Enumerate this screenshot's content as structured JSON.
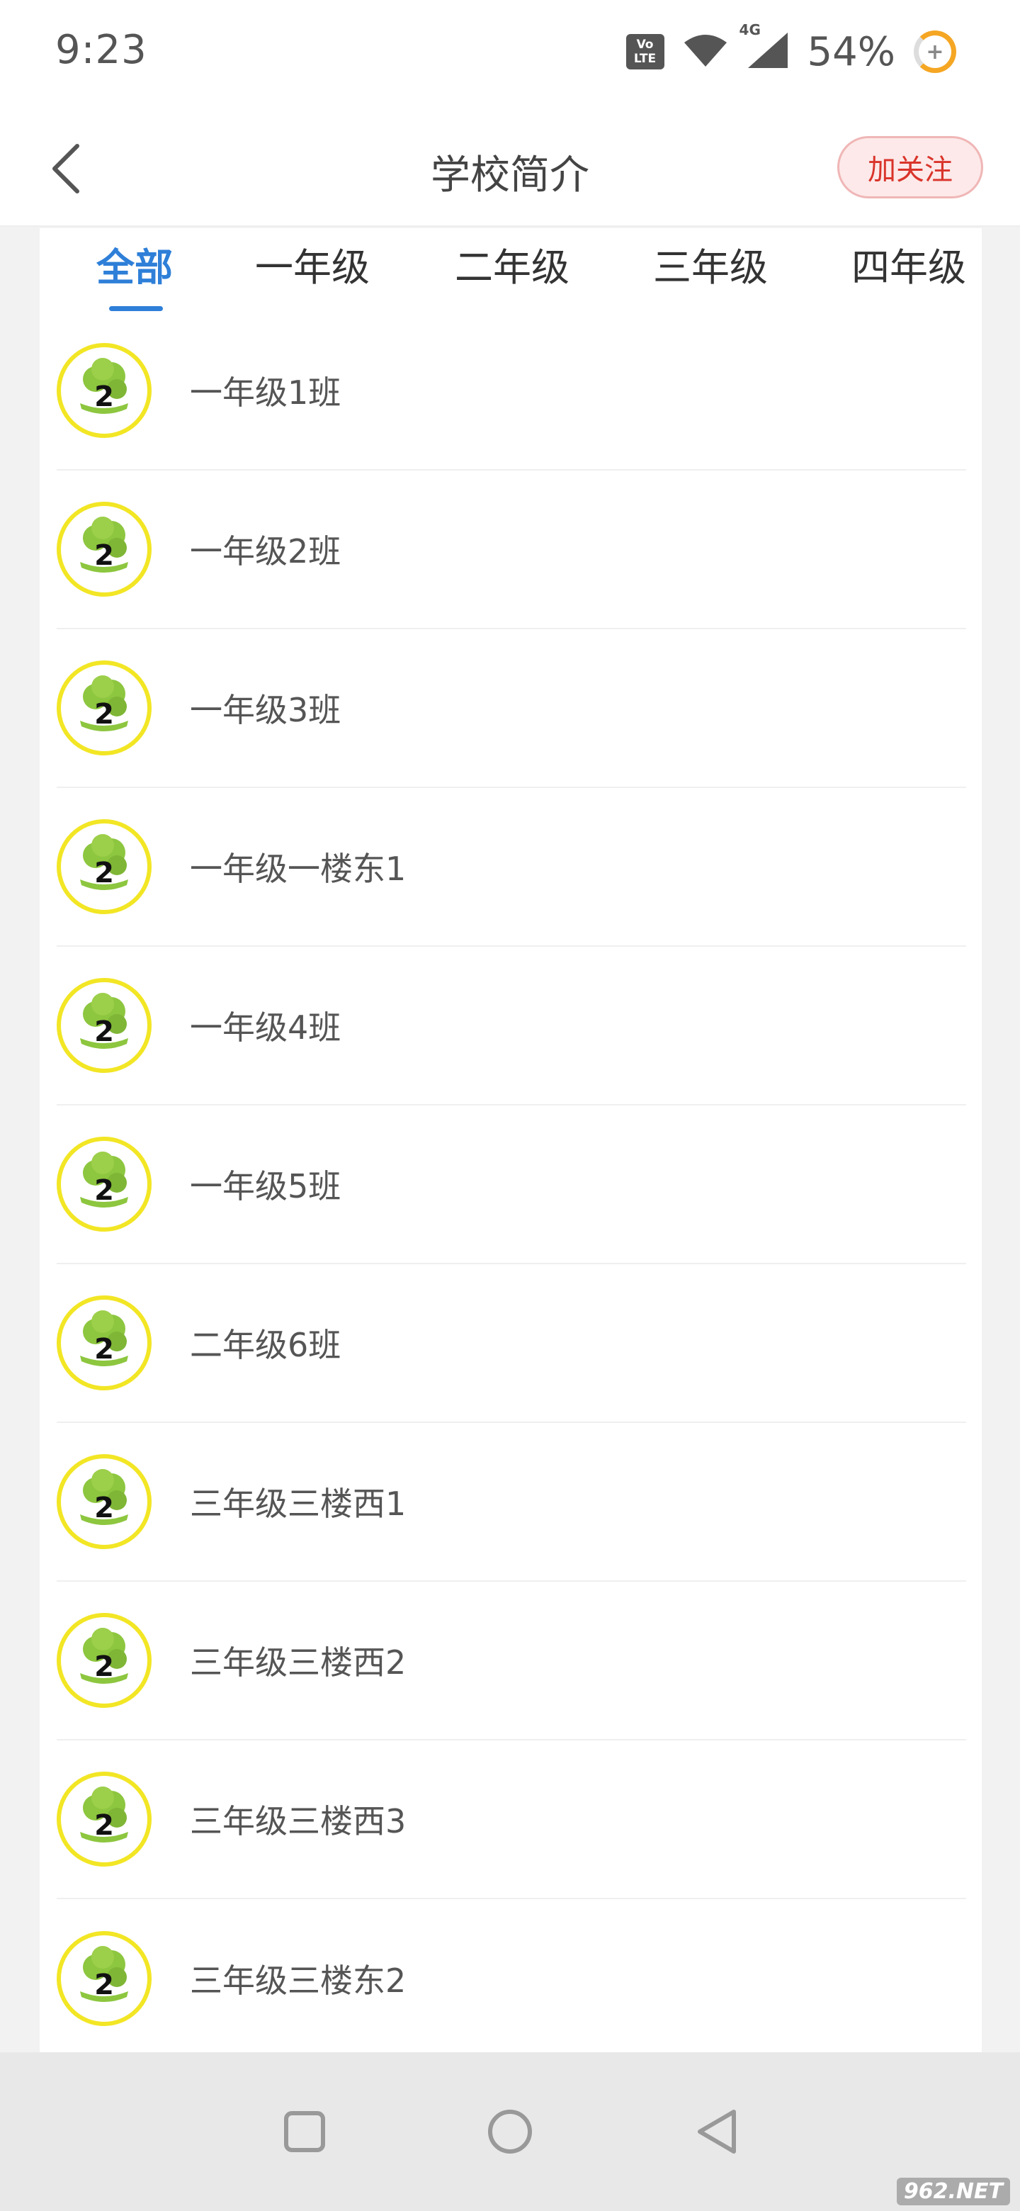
{
  "status_bar": {
    "time": "9:23",
    "volte_label": "Vo LTE",
    "network_label": "4G",
    "battery_percent": "54%",
    "icons": [
      "volte-icon",
      "wifi-icon",
      "cell-signal-icon",
      "battery-icon"
    ]
  },
  "header": {
    "title": "学校简介",
    "follow_button": "加关注"
  },
  "tabs": [
    {
      "label": "全部",
      "active": true
    },
    {
      "label": "一年级",
      "active": false
    },
    {
      "label": "二年级",
      "active": false
    },
    {
      "label": "三年级",
      "active": false
    },
    {
      "label": "四年级",
      "active": false
    }
  ],
  "classes": [
    {
      "name": "一年级1班"
    },
    {
      "name": "一年级2班"
    },
    {
      "name": "一年级3班"
    },
    {
      "name": "一年级一楼东1"
    },
    {
      "name": "一年级4班"
    },
    {
      "name": "一年级5班"
    },
    {
      "name": "二年级6班"
    },
    {
      "name": "三年级三楼西1"
    },
    {
      "name": "三年级三楼西2"
    },
    {
      "name": "三年级三楼西3"
    },
    {
      "name": "三年级三楼东2"
    }
  ],
  "nav_bar": {
    "icons": [
      "recents-square-icon",
      "home-circle-icon",
      "back-triangle-icon"
    ]
  },
  "watermark": "962.NET",
  "colors": {
    "accent": "#2e7fd8",
    "follow_text": "#d9342b",
    "follow_bg": "#fde9e9",
    "avatar_border": "#f2e625",
    "tree_green": "#8dc63f"
  }
}
